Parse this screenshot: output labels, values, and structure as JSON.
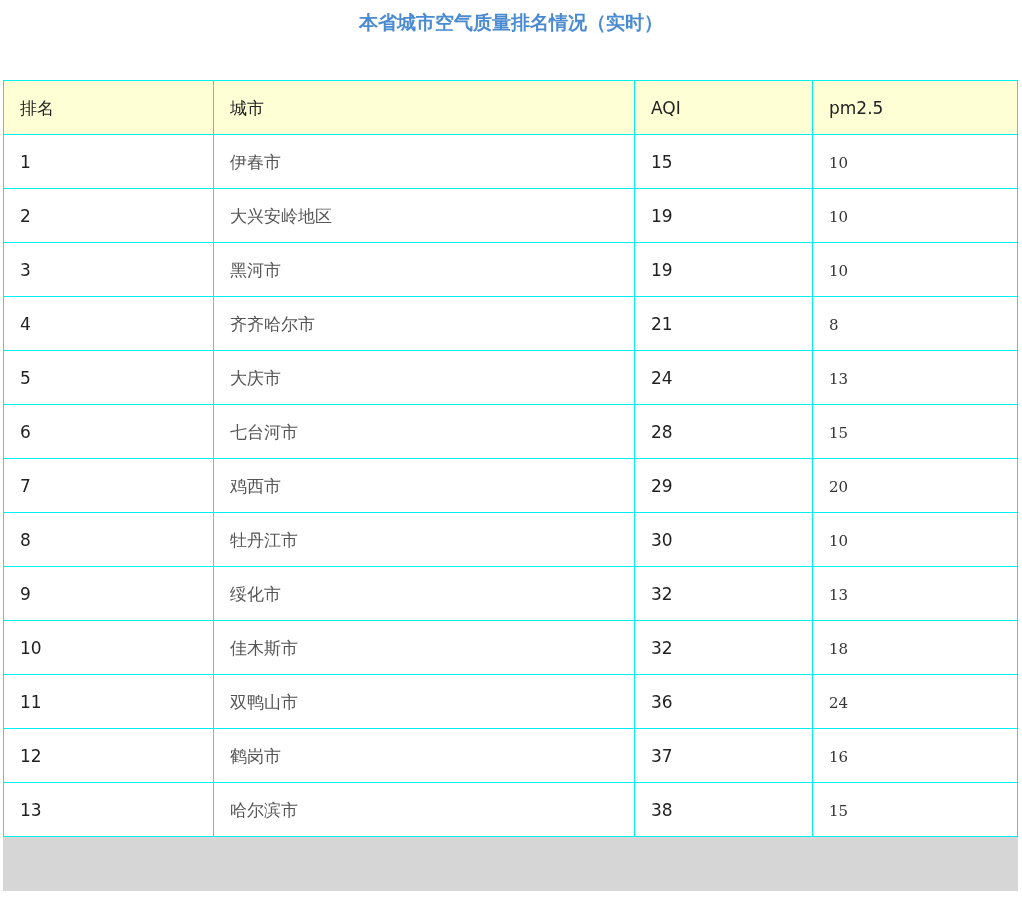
{
  "title": "本省城市空气质量排名情况（实时）",
  "table": {
    "columns": [
      "排名",
      "城市",
      "AQI",
      "pm2.5"
    ],
    "rows": [
      [
        "1",
        "伊春市",
        "15",
        "10"
      ],
      [
        "2",
        "大兴安岭地区",
        "19",
        "10"
      ],
      [
        "3",
        "黑河市",
        "19",
        "10"
      ],
      [
        "4",
        "齐齐哈尔市",
        "21",
        "8"
      ],
      [
        "5",
        "大庆市",
        "24",
        "13"
      ],
      [
        "6",
        "七台河市",
        "28",
        "15"
      ],
      [
        "7",
        "鸡西市",
        "29",
        "20"
      ],
      [
        "8",
        "牡丹江市",
        "30",
        "10"
      ],
      [
        "9",
        "绥化市",
        "32",
        "13"
      ],
      [
        "10",
        "佳木斯市",
        "32",
        "18"
      ],
      [
        "11",
        "双鸭山市",
        "36",
        "24"
      ],
      [
        "12",
        "鹤岗市",
        "37",
        "16"
      ],
      [
        "13",
        "哈尔滨市",
        "38",
        "15"
      ]
    ]
  }
}
